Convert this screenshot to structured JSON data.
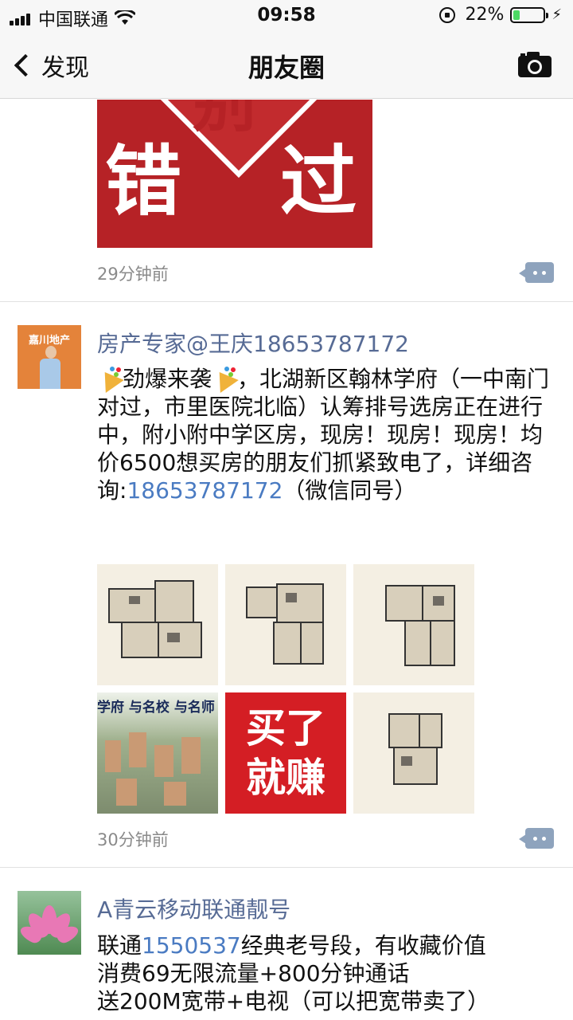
{
  "status_bar": {
    "carrier": "中国联通",
    "time": "09:58",
    "battery_percent": "22%",
    "battery_level": 0.22
  },
  "nav": {
    "back_label": "发现",
    "title": "朋友圈"
  },
  "posts": [
    {
      "image_chars": [
        "错",
        "过",
        "别"
      ],
      "time": "29分钟前"
    },
    {
      "name": "房产专家@王庆18653787172",
      "avatar_banner": "嘉川地产",
      "text_1": "劲爆来袭",
      "text_2": "，北湖新区翰林学府（一中南门对过，市里医院北临）认筹排号选房正在进行中，附小附中学区房，现房！现房！现房！均价6500想买房的朋友们抓紧致电了，详细咨询:",
      "phone": "18653787172",
      "text_3": "（微信同号）",
      "images": {
        "aerial_caption": "学府 与名校 与名师",
        "promo_line1": "买了",
        "promo_line2": "就赚"
      },
      "time": "30分钟前"
    },
    {
      "name": "A青云移动联通靓号",
      "line1_prefix": "联通",
      "line1_link": "1550537",
      "line1_suffix": "经典老号段，有收藏价值",
      "line2": "消费69无限流量+800分钟通话",
      "line3": "送200M宽带+电视（可以把宽带卖了）"
    }
  ],
  "colors": {
    "name_blue": "#576b95",
    "link_blue": "#4a7bc2",
    "time_gray": "#8a8a8a",
    "promo_red": "#d41e24"
  }
}
